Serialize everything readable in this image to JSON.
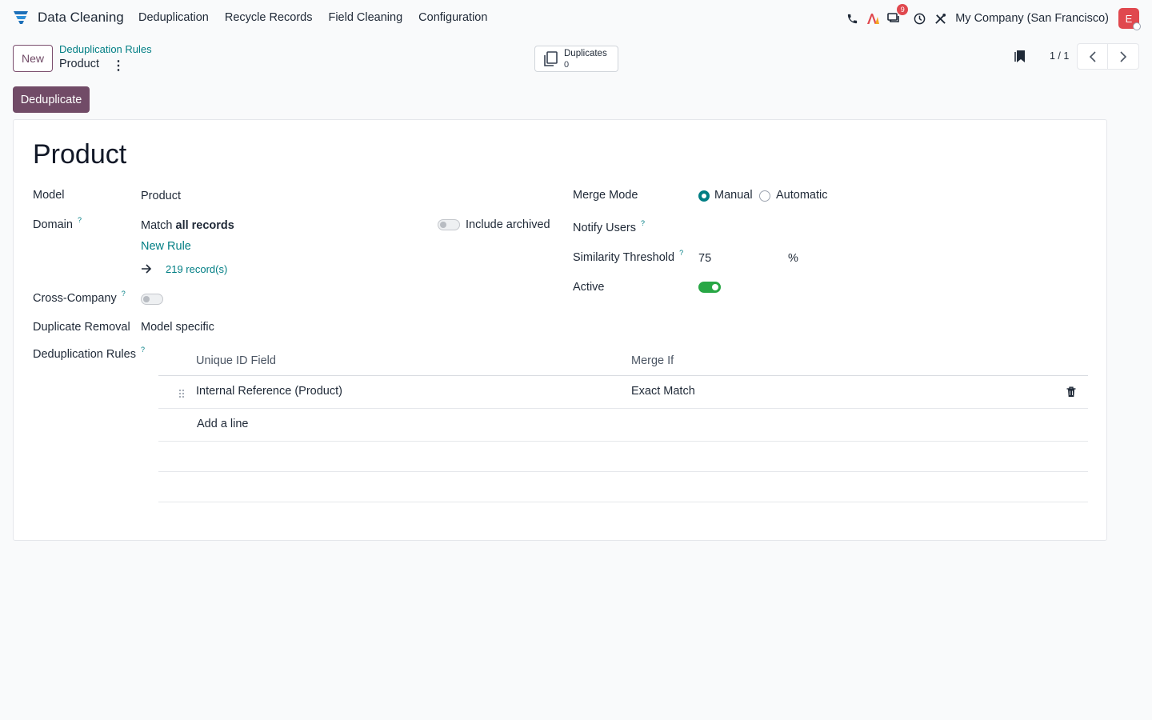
{
  "navbar": {
    "app_name": "Data Cleaning",
    "menu": [
      "Deduplication",
      "Recycle Records",
      "Field Cleaning",
      "Configuration"
    ],
    "messages_badge": "9",
    "company": "My Company (San Francisco)",
    "avatar_initial": "E"
  },
  "control_panel": {
    "new_label": "New",
    "breadcrumb_parent": "Deduplication Rules",
    "breadcrumb_current": "Product",
    "smart_button": {
      "label": "Duplicates",
      "value": "0"
    },
    "pager": "1 / 1",
    "primary_action": "Deduplicate"
  },
  "form": {
    "title": "Product",
    "model": {
      "label": "Model",
      "value": "Product"
    },
    "domain": {
      "label": "Domain",
      "match_prefix": "Match ",
      "match_bold": "all records",
      "include_archived_label": "Include archived",
      "include_archived": false,
      "new_rule": "New Rule",
      "records": "219 record(s)"
    },
    "cross_company": {
      "label": "Cross-Company",
      "value": false
    },
    "duplicate_removal": {
      "label": "Duplicate Removal",
      "value": "Model specific"
    },
    "merge_mode": {
      "label": "Merge Mode",
      "options": [
        "Manual",
        "Automatic"
      ],
      "selected": "Manual"
    },
    "notify_users": {
      "label": "Notify Users"
    },
    "similarity_threshold": {
      "label": "Similarity Threshold",
      "value": "75",
      "unit": "%"
    },
    "active": {
      "label": "Active",
      "value": true
    },
    "rules": {
      "label": "Deduplication Rules",
      "columns": [
        "Unique ID Field",
        "Merge If"
      ],
      "rows": [
        {
          "field": "Internal Reference (Product)",
          "merge_if": "Exact Match"
        }
      ],
      "add_line": "Add a line"
    },
    "help_marker": "?"
  },
  "colors": {
    "brand": "#714b67",
    "link": "#017e84",
    "toggle_on": "#28a745",
    "badge": "#e0484e"
  }
}
